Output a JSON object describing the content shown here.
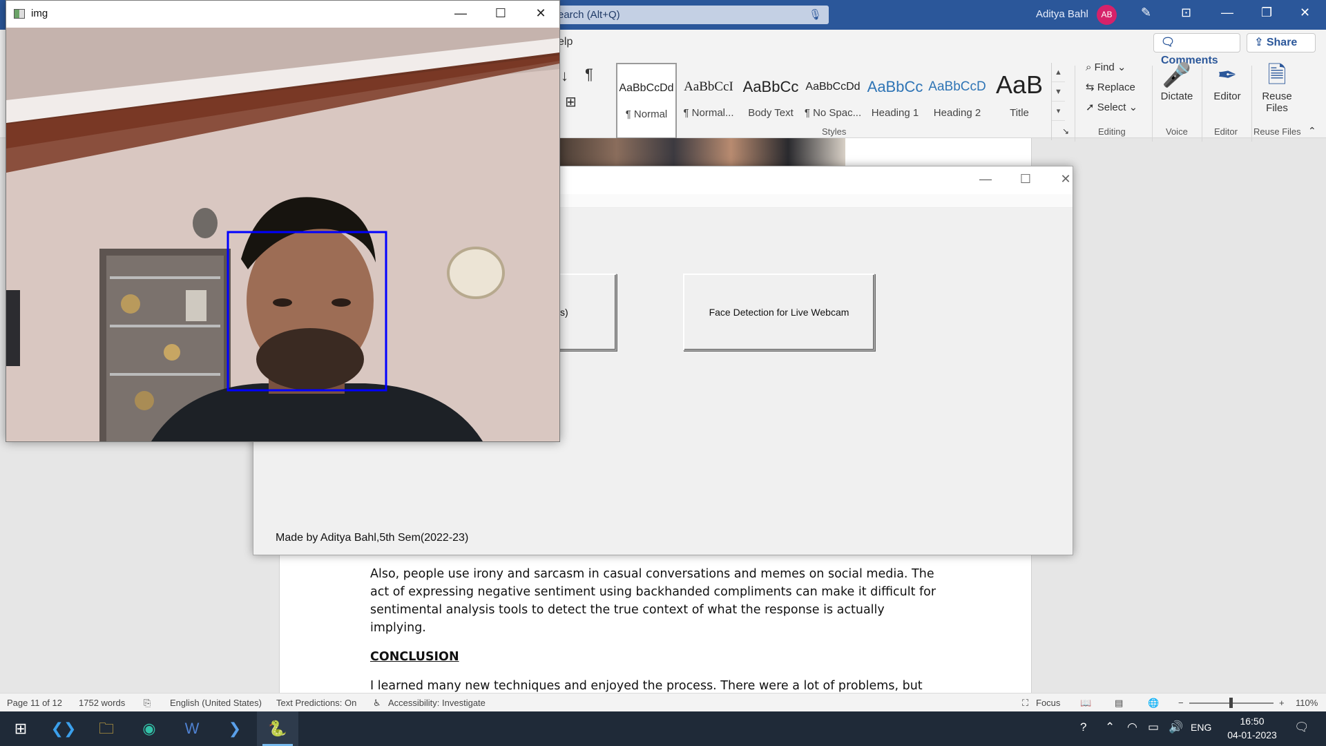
{
  "word": {
    "search_placeholder": "earch (Alt+Q)",
    "user_name": "Aditya Bahl",
    "user_initials": "AB",
    "tab_help": "elp",
    "comments_label": "Comments",
    "share_label": "Share",
    "styles": [
      {
        "sample": "AaBbCcDd",
        "name": "¶ Normal"
      },
      {
        "sample": "AaBbCcI",
        "name": "¶ Normal..."
      },
      {
        "sample": "AaBbCc",
        "name": "Body Text"
      },
      {
        "sample": "AaBbCcDd",
        "name": "¶ No Spac..."
      },
      {
        "sample": "AaBbCc",
        "name": "Heading 1"
      },
      {
        "sample": "AaBbCcD",
        "name": "Heading 2"
      },
      {
        "sample": "AaB",
        "name": "Title"
      }
    ],
    "groups": {
      "styles": "Styles",
      "editing": "Editing",
      "voice": "Voice",
      "editor": "Editor",
      "reuse": "Reuse Files"
    },
    "editing": {
      "find": "Find",
      "replace": "Replace",
      "select": "Select"
    },
    "buttons": {
      "dictate": "Dictate",
      "editor": "Editor",
      "reuse_files": "Reuse Files"
    },
    "document": {
      "para1": "Also, people use irony and sarcasm in casual conversations and memes on social media. The act of expressing negative sentiment using backhanded compliments can make it difficult for sentimental analysis tools to detect the true context of what the response is actually implying.",
      "heading": "CONCLUSION",
      "para2": "I learned many new techniques and enjoyed the process. There were a lot of problems, but removing errors, yeah, that’s what we have to learn. The project may not give accurate results in"
    },
    "status": {
      "page": "Page 11 of 12",
      "words": "1752 words",
      "language": "English (United States)",
      "predictions": "Text Predictions: On",
      "accessibility": "Accessibility: Investigate",
      "focus": "Focus",
      "zoom": "110%"
    }
  },
  "tk_app": {
    "button_sample": "n for sample image(s)",
    "button_webcam": "Face Detection for Live Webcam",
    "footer": "Made by Aditya Bahl,5th Sem(2022-23)"
  },
  "cv_window": {
    "title": "img",
    "face_box_color": "#0000ff"
  },
  "taskbar": {
    "apps": [
      "windows-start",
      "vscode",
      "file-explorer",
      "edge",
      "word",
      "powershell",
      "python"
    ],
    "lang": "ENG",
    "time": "16:50",
    "date": "04-01-2023"
  },
  "colors": {
    "word_blue": "#2b579a",
    "taskbar": "#1f2a38"
  }
}
